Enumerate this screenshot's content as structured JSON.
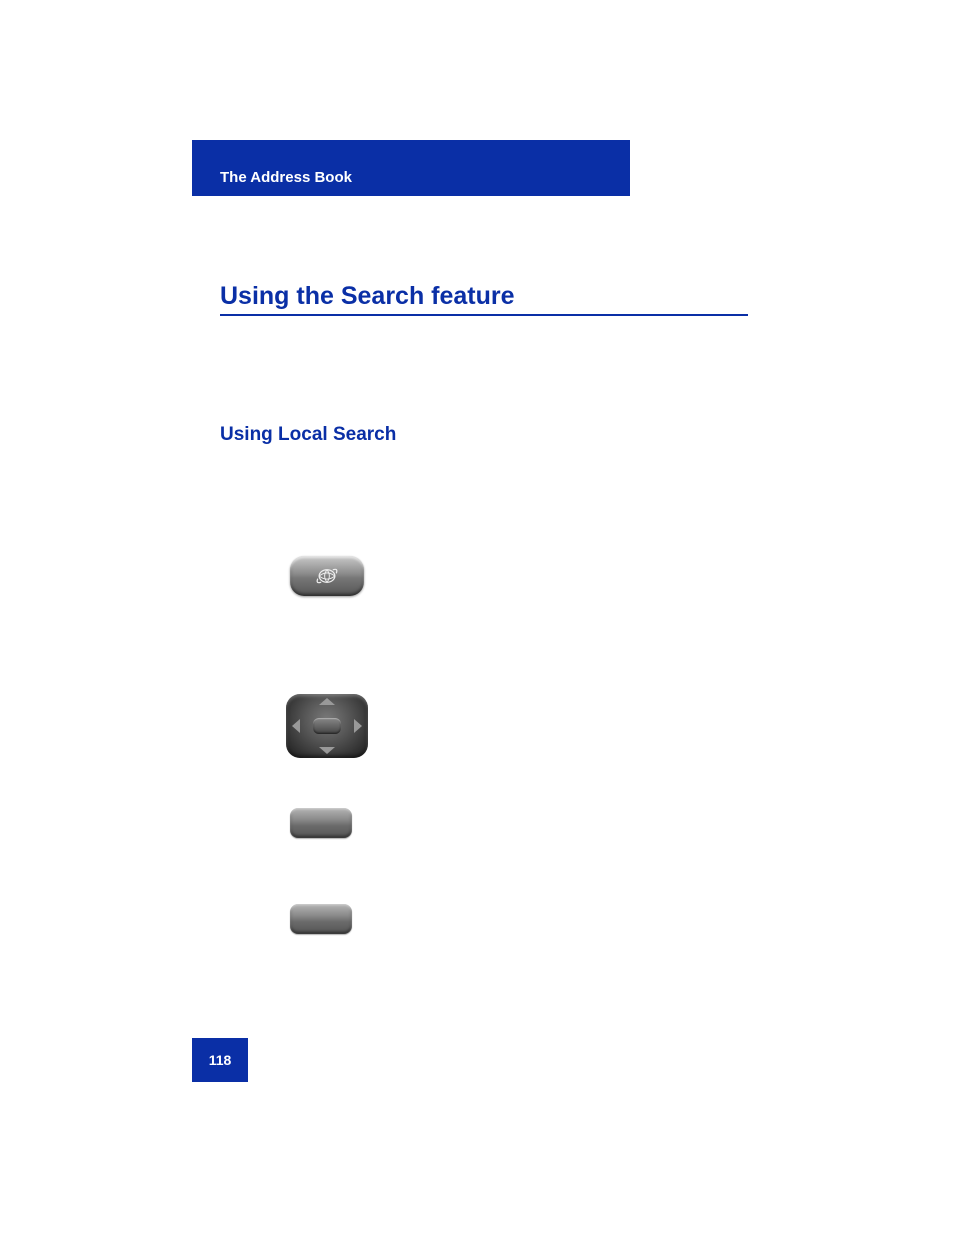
{
  "header": {
    "section_title": "The Address Book"
  },
  "titles": {
    "main": "Using the Search feature",
    "sub": "Using Local Search"
  },
  "page_number": "118"
}
